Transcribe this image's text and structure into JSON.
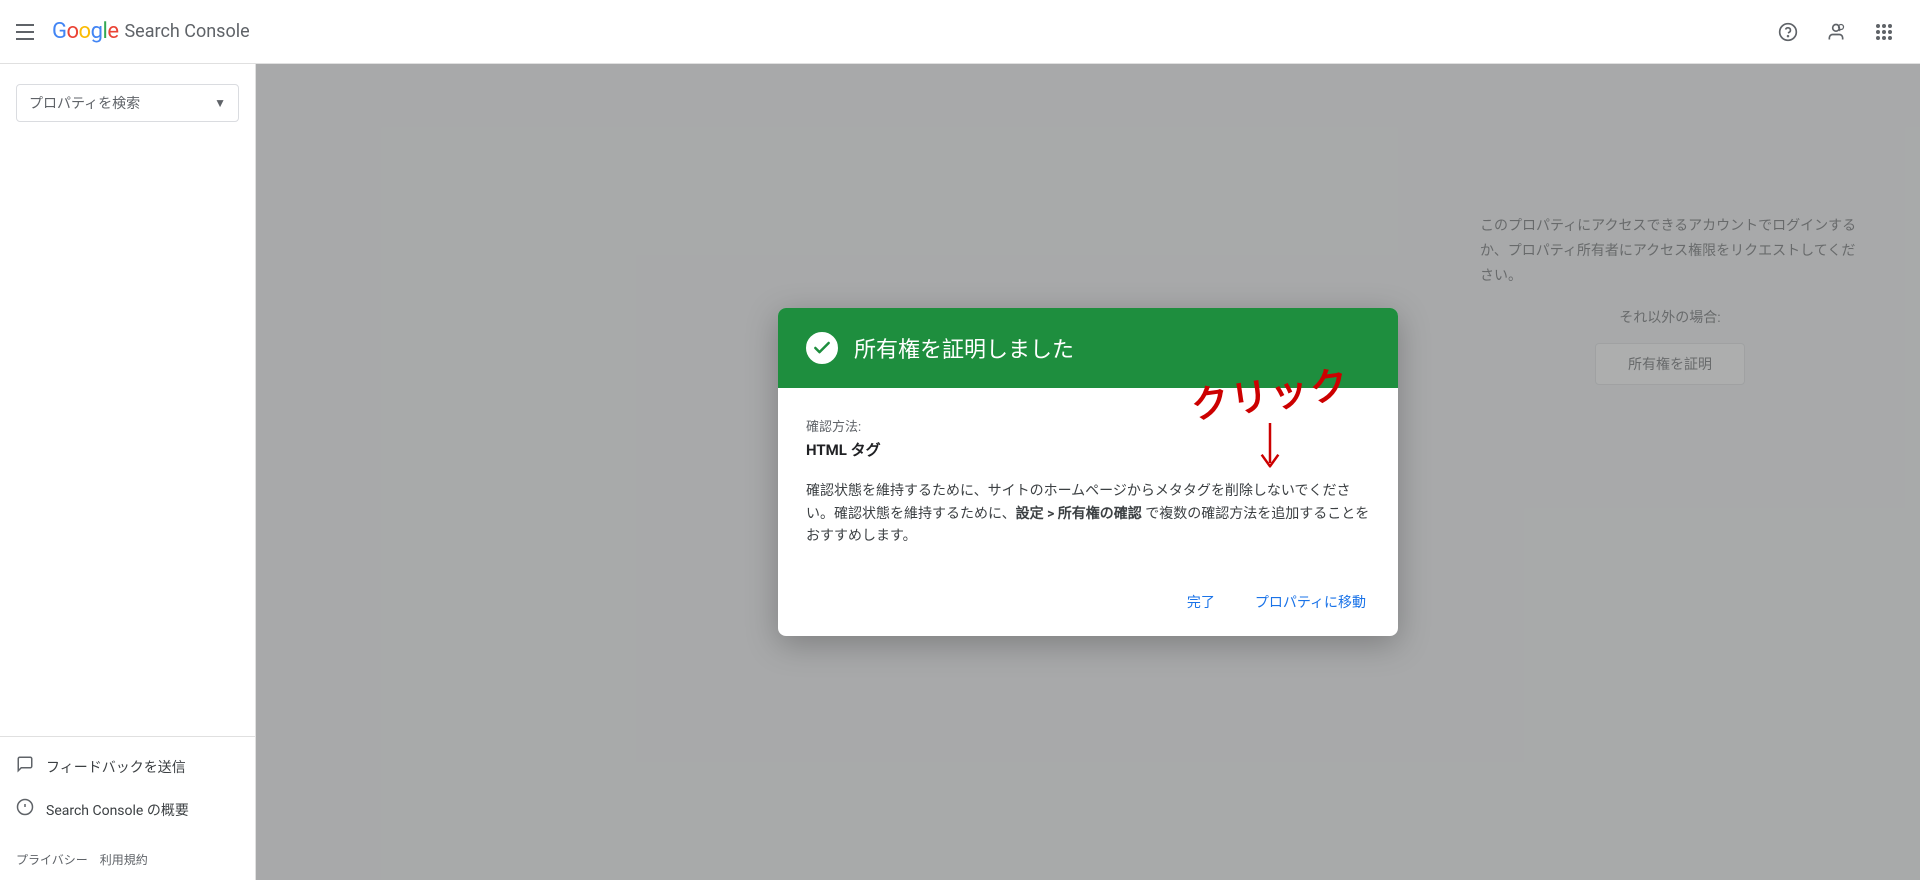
{
  "app": {
    "title": "Google Search Console",
    "google_text": "Google",
    "search_console_text": "Search Console"
  },
  "header": {
    "help_icon": "help-icon",
    "account_icon": "account-icon",
    "apps_icon": "apps-icon"
  },
  "sidebar": {
    "property_search_placeholder": "プロパティを検索",
    "items": [
      {
        "label": "フィードバックを送信",
        "icon": "feedback"
      },
      {
        "label": "Search Console の概要",
        "icon": "info"
      }
    ],
    "footer": {
      "privacy": "プライバシー",
      "terms": "利用規約"
    }
  },
  "dialog": {
    "header_title": "所有権を証明しました",
    "verification_label": "確認方法:",
    "verification_value": "HTML タグ",
    "description_line1": "確認状態を維持するために、サイトのホームページからメタタグを削除しないでください。確認状態を維持するために、",
    "description_bold": "設定 > 所有権の確認",
    "description_line2": " で複数の確認方法を追加することをおすすめします。",
    "btn_done": "完了",
    "btn_go_to_property": "プロパティに移動"
  },
  "annotation": {
    "click_text": "クリック",
    "arrow": "↓"
  },
  "bg": {
    "access_text": "このプロパティにアクセスできるアカウントでログインするか、プロパティ所有者にアクセス権限をリクエストしてください。",
    "other_case": "それ以外の場合:",
    "ownership_btn": "所有権を証明"
  }
}
